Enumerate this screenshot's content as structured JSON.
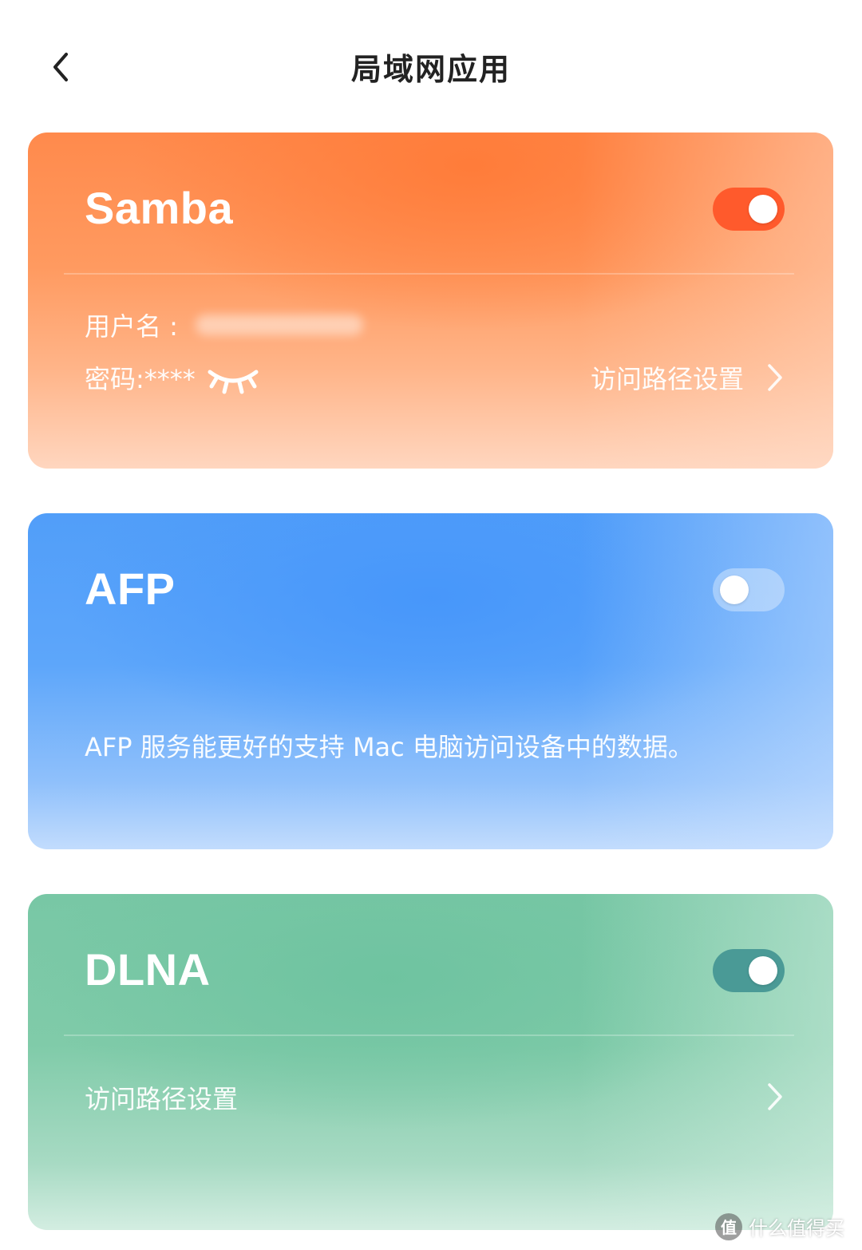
{
  "header": {
    "title": "局域网应用",
    "back_icon": "chevron-left-icon"
  },
  "samba": {
    "title": "Samba",
    "enabled": true,
    "toggle_color": "#ff5a2c",
    "username_label": "用户名 :",
    "password_label": "密码:****",
    "eye_icon": "eye-closed-icon",
    "path_label": "访问路径设置"
  },
  "afp": {
    "title": "AFP",
    "enabled": false,
    "description": "AFP 服务能更好的支持 Mac 电脑访问设备中的数据。"
  },
  "dlna": {
    "title": "DLNA",
    "enabled": true,
    "toggle_color": "#4a9a96",
    "path_label": "访问路径设置"
  },
  "watermark": {
    "badge": "值",
    "text": "什么值得买"
  }
}
